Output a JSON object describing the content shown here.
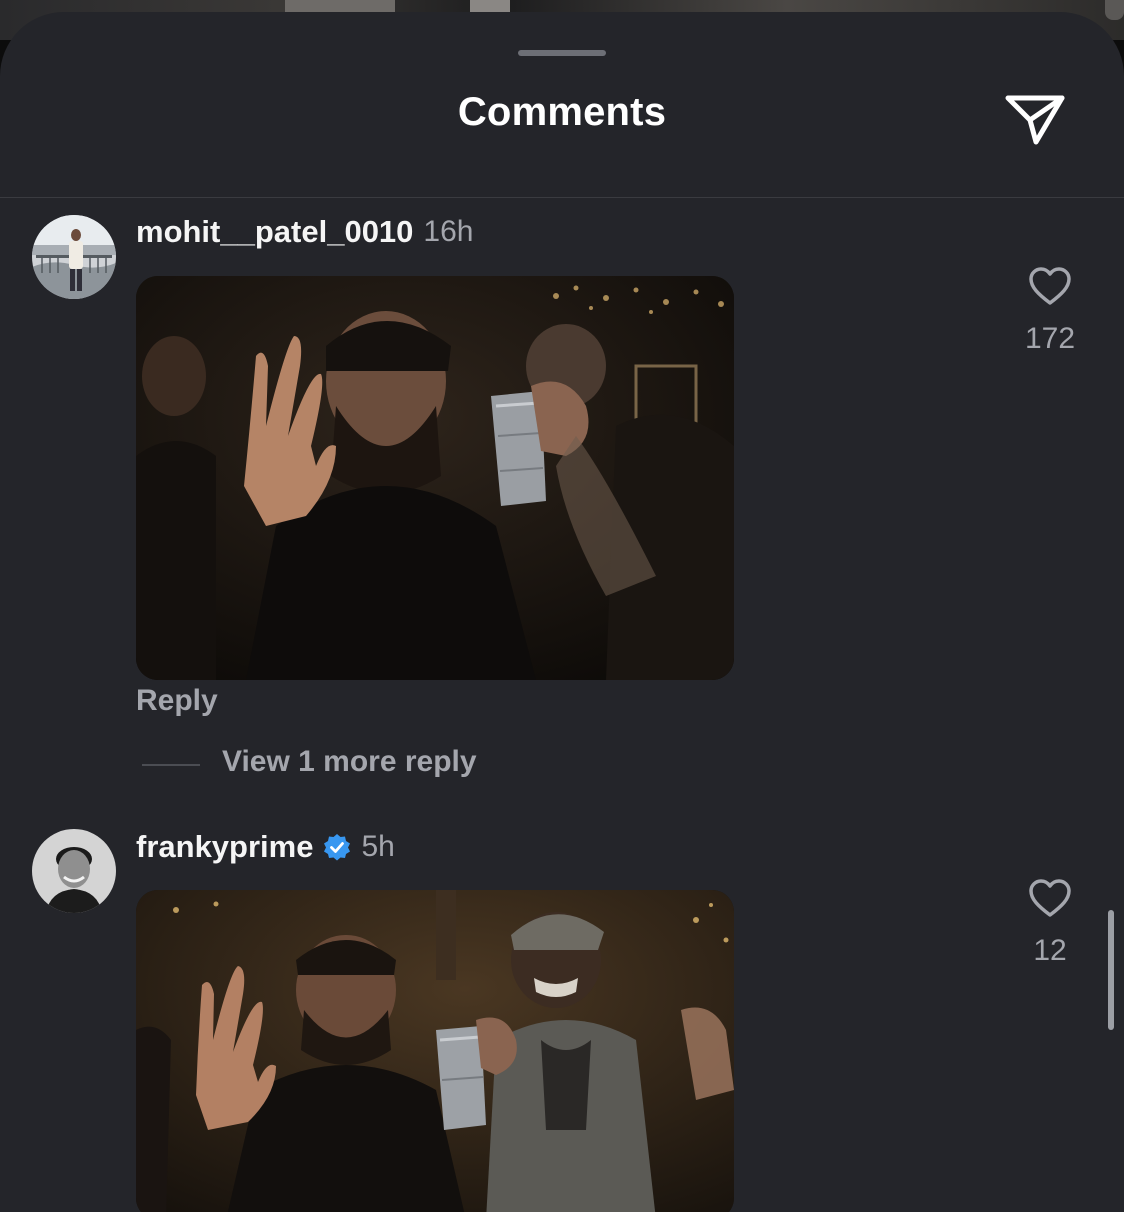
{
  "header": {
    "title": "Comments",
    "share_icon": "send-icon"
  },
  "comments": [
    {
      "username": "mohit__patel_0010",
      "time": "16h",
      "verified": false,
      "likes": "172",
      "reply_label": "Reply",
      "more_replies_label": "View 1 more reply"
    },
    {
      "username": "frankyprime",
      "time": "5h",
      "verified": true,
      "likes": "12"
    }
  ],
  "colors": {
    "background": "#24252a",
    "text": "#f5f5f5",
    "muted": "#a4a6ad",
    "verified": "#3897f0"
  }
}
